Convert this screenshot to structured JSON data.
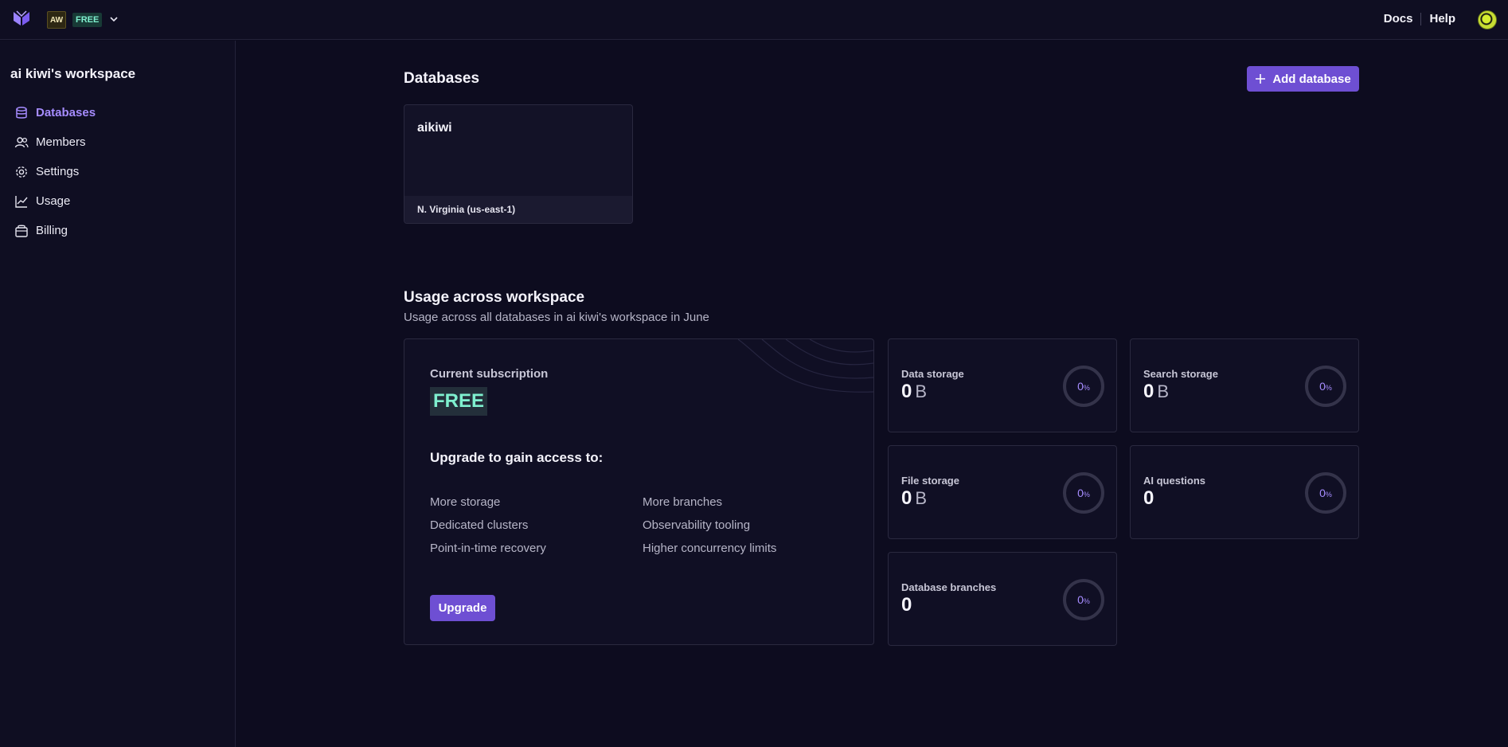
{
  "topbar": {
    "workspace_initials": "AW",
    "plan": "FREE",
    "links": [
      "Docs",
      "Help"
    ]
  },
  "sidebar": {
    "workspace_title": "ai kiwi's workspace",
    "items": [
      {
        "label": "Databases",
        "icon": "database-icon",
        "active": true
      },
      {
        "label": "Members",
        "icon": "users-icon",
        "active": false
      },
      {
        "label": "Settings",
        "icon": "gear-icon",
        "active": false
      },
      {
        "label": "Usage",
        "icon": "chart-line-icon",
        "active": false
      },
      {
        "label": "Billing",
        "icon": "wallet-icon",
        "active": false
      }
    ]
  },
  "databases": {
    "title": "Databases",
    "add_label": "Add database",
    "cards": [
      {
        "name": "aikiwi",
        "region": "N. Virginia (us-east-1)"
      }
    ]
  },
  "usage": {
    "title": "Usage across workspace",
    "subtitle": "Usage across all databases in ai kiwi's workspace in June",
    "subscription": {
      "label": "Current subscription",
      "plan": "FREE",
      "upgrade_heading": "Upgrade to gain access to:",
      "features_left": [
        "More storage",
        "Dedicated clusters",
        "Point-in-time recovery"
      ],
      "features_right": [
        "More branches",
        "Observability tooling",
        "Higher concurrency limits"
      ],
      "button": "Upgrade"
    },
    "stats": [
      {
        "label": "Data storage",
        "value": "0",
        "unit": "B",
        "percent": "0",
        "pct_symbol": "%"
      },
      {
        "label": "Search storage",
        "value": "0",
        "unit": "B",
        "percent": "0",
        "pct_symbol": "%"
      },
      {
        "label": "File storage",
        "value": "0",
        "unit": "B",
        "percent": "0",
        "pct_symbol": "%"
      },
      {
        "label": "AI questions",
        "value": "0",
        "unit": "",
        "percent": "0",
        "pct_symbol": "%"
      },
      {
        "label": "Database branches",
        "value": "0",
        "unit": "",
        "percent": "0",
        "pct_symbol": "%"
      }
    ]
  },
  "colors": {
    "background": "#0d0c1f",
    "accent": "#6e4fd3",
    "accent_text": "#a68cff",
    "plan_text": "#7ff0cf"
  }
}
